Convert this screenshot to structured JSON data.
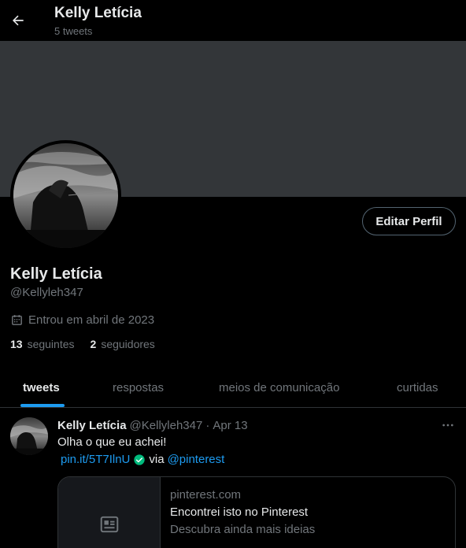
{
  "header": {
    "title": "Kelly Letícia",
    "tweet_count": "5 tweets"
  },
  "profile": {
    "name": "Kelly Letícia",
    "handle": "@Kellyleh347",
    "joined": "Entrou em abril de 2023",
    "following_count": "13",
    "following_label": "seguintes",
    "followers_count": "2",
    "followers_label": "seguidores",
    "edit_button": "Editar Perfil"
  },
  "tabs": [
    {
      "label": "tweets",
      "active": true
    },
    {
      "label": "respostas",
      "active": false
    },
    {
      "label": "meios de comunicação",
      "active": false
    },
    {
      "label": "curtidas",
      "active": false
    }
  ],
  "tweet": {
    "name": "Kelly Letícia",
    "handle": "@Kellyleh347",
    "separator": "·",
    "date": "Apr 13",
    "text": "Olha o que eu achei!",
    "link": "pin.it/5T7IlnU",
    "via": "via",
    "mention": "@pinterest",
    "card": {
      "domain": "pinterest.com",
      "title": "Encontrei isto no Pinterest",
      "description": "Descubra ainda mais ideias"
    }
  },
  "colors": {
    "accent": "#1d9bf0",
    "verified": "#00ba7c",
    "banner": "#333639",
    "muted": "#71767b"
  },
  "icons": [
    "back-arrow-icon",
    "calendar-icon",
    "verified-check-icon",
    "more-dots-icon",
    "article-icon"
  ]
}
